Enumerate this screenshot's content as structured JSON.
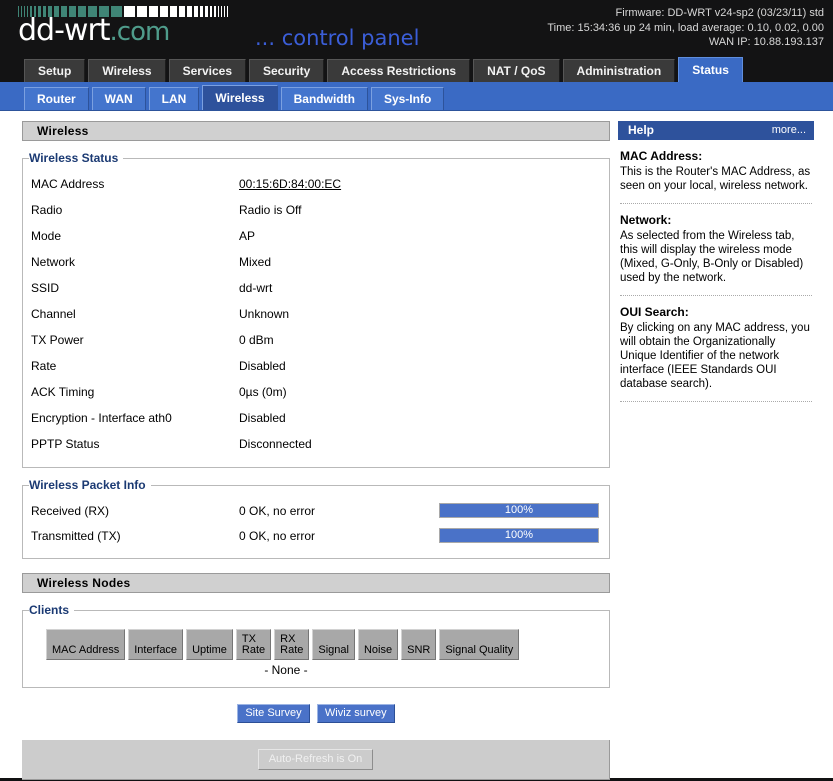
{
  "brand": {
    "name": "dd-wrt",
    "domain": ".com",
    "tagline": "... control panel",
    "logo_bar_color": "#3f8576",
    "logo_bar_color_light": "#ffffff"
  },
  "header_info": {
    "firmware": "Firmware: DD-WRT v24-sp2 (03/23/11) std",
    "time": "Time: 15:34:36 up 24 min, load average: 0.10, 0.02, 0.00",
    "wan_ip": "WAN IP: 10.88.193.137"
  },
  "main_tabs": [
    {
      "label": "Setup",
      "active": false
    },
    {
      "label": "Wireless",
      "active": false
    },
    {
      "label": "Services",
      "active": false
    },
    {
      "label": "Security",
      "active": false
    },
    {
      "label": "Access Restrictions",
      "active": false
    },
    {
      "label": "NAT / QoS",
      "active": false
    },
    {
      "label": "Administration",
      "active": false
    },
    {
      "label": "Status",
      "active": true
    }
  ],
  "sub_tabs": [
    {
      "label": "Router",
      "active": false
    },
    {
      "label": "WAN",
      "active": false
    },
    {
      "label": "LAN",
      "active": false
    },
    {
      "label": "Wireless",
      "active": true
    },
    {
      "label": "Bandwidth",
      "active": false
    },
    {
      "label": "Sys-Info",
      "active": false
    }
  ],
  "wireless_section": {
    "title": "Wireless"
  },
  "wireless_status": {
    "legend": "Wireless Status",
    "rows": [
      {
        "label": "MAC Address",
        "value": "00:15:6D:84:00:EC",
        "link": true
      },
      {
        "label": "Radio",
        "value": "Radio is Off",
        "link": false
      },
      {
        "label": "Mode",
        "value": "AP",
        "link": false
      },
      {
        "label": "Network",
        "value": "Mixed",
        "link": false
      },
      {
        "label": "SSID",
        "value": "dd-wrt",
        "link": false
      },
      {
        "label": "Channel",
        "value": "Unknown",
        "link": false
      },
      {
        "label": "TX Power",
        "value": "0 dBm",
        "link": false
      },
      {
        "label": "Rate",
        "value": "Disabled",
        "link": false
      },
      {
        "label": "ACK Timing",
        "value": "0µs (0m)",
        "link": false
      },
      {
        "label": "Encryption - Interface ath0",
        "value": "Disabled",
        "link": false
      },
      {
        "label": "PPTP Status",
        "value": "Disconnected",
        "link": false
      }
    ]
  },
  "packet_info": {
    "legend": "Wireless Packet Info",
    "rows": [
      {
        "label": "Received (RX)",
        "value": "0 OK, no error",
        "percent_label": "100%",
        "percent": 100
      },
      {
        "label": "Transmitted (TX)",
        "value": "0 OK, no error",
        "percent_label": "100%",
        "percent": 100
      }
    ]
  },
  "nodes_section": {
    "title": "Wireless Nodes"
  },
  "clients": {
    "legend": "Clients",
    "columns": [
      "MAC Address",
      "Interface",
      "Uptime",
      "TX\nRate",
      "RX\nRate",
      "Signal",
      "Noise",
      "SNR",
      "Signal Quality"
    ],
    "empty_text": "- None -",
    "rows": []
  },
  "buttons": {
    "site_survey": "Site Survey",
    "wiviz_survey": "Wiviz survey",
    "auto_refresh": "Auto-Refresh is On"
  },
  "help": {
    "title": "Help",
    "more": "more...",
    "entries": [
      {
        "term": "MAC Address:",
        "text": "This is the Router's MAC Address, as seen on your local, wireless network."
      },
      {
        "term": "Network:",
        "text": "As selected from the Wireless tab, this will display the wireless mode (Mixed, G-Only, B-Only or Disabled) used by the network."
      },
      {
        "term": "OUI Search:",
        "text": "By clicking on any MAC address, you will obtain the Organizationally Unique Identifier of the network interface (IEEE Standards OUI database search)."
      }
    ]
  }
}
